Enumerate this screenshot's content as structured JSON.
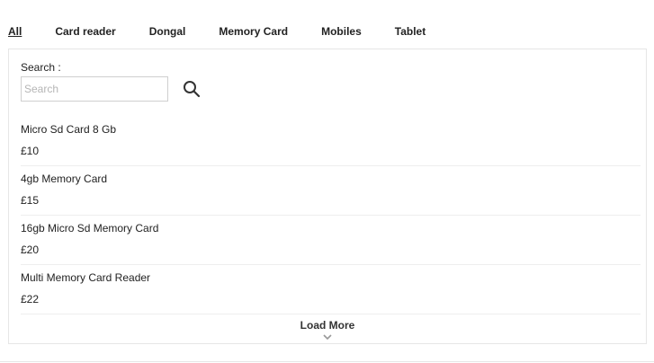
{
  "tabs": [
    {
      "label": "All",
      "active": true
    },
    {
      "label": "Card reader"
    },
    {
      "label": "Dongal"
    },
    {
      "label": "Memory Card"
    },
    {
      "label": "Mobiles"
    },
    {
      "label": "Tablet"
    }
  ],
  "search": {
    "label": "Search :",
    "placeholder": "Search",
    "value": ""
  },
  "products": [
    {
      "name": "Micro Sd Card 8 Gb",
      "price": "£10"
    },
    {
      "name": "4gb Memory Card",
      "price": "£15"
    },
    {
      "name": "16gb Micro Sd Memory Card",
      "price": "£20"
    },
    {
      "name": "Multi Memory Card Reader",
      "price": "£22"
    }
  ],
  "load_more": {
    "label": "Load More"
  },
  "icons": {
    "search": "search-icon",
    "load_more": "chevron-down-icon"
  }
}
